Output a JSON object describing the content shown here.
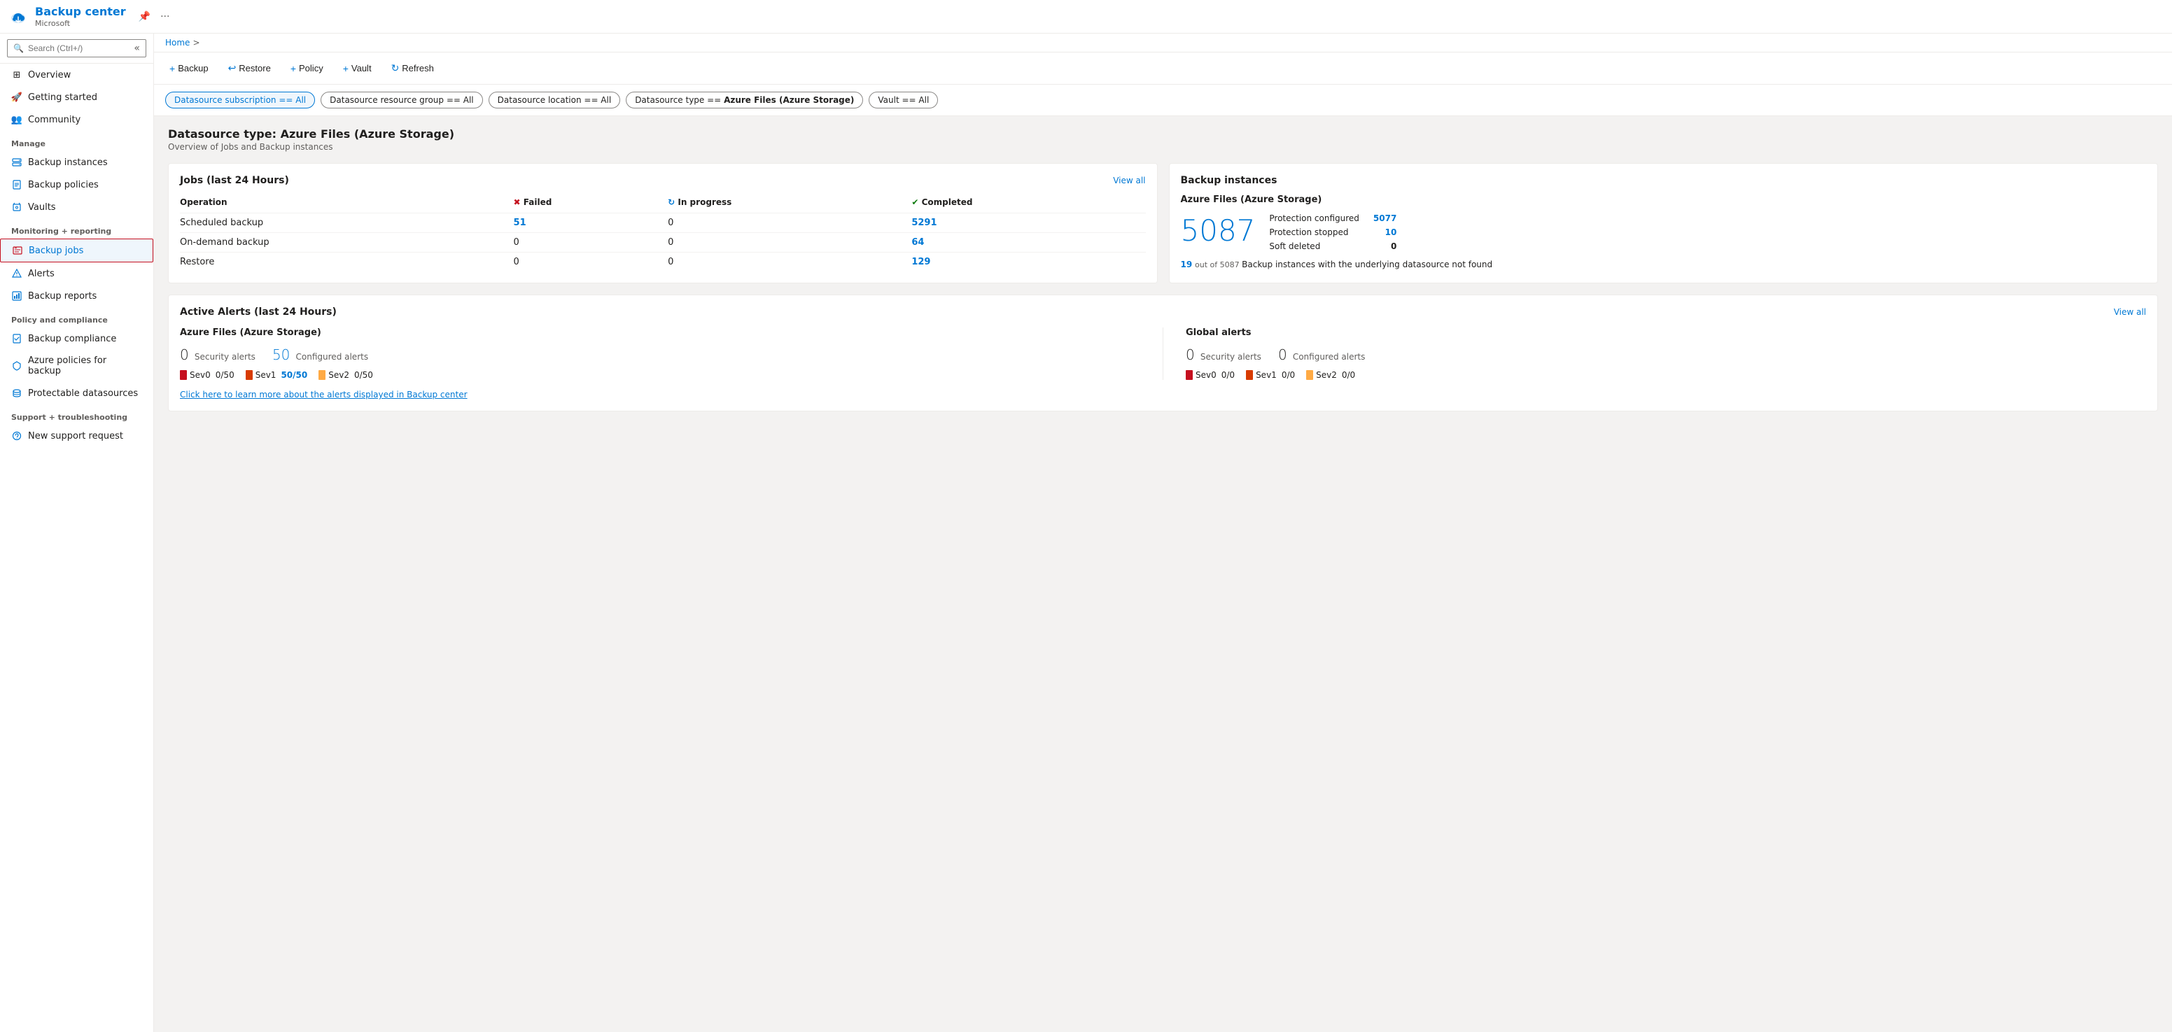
{
  "header": {
    "title": "Backup center",
    "subtitle": "Microsoft",
    "pin_label": "📌",
    "more_label": "..."
  },
  "breadcrumb": {
    "home": "Home",
    "separator": ">"
  },
  "search": {
    "placeholder": "Search (Ctrl+/)"
  },
  "sidebar": {
    "nav_items": [
      {
        "id": "overview",
        "label": "Overview",
        "icon": "grid"
      },
      {
        "id": "getting-started",
        "label": "Getting started",
        "icon": "rocket"
      },
      {
        "id": "community",
        "label": "Community",
        "icon": "people"
      }
    ],
    "sections": [
      {
        "label": "Manage",
        "items": [
          {
            "id": "backup-instances",
            "label": "Backup instances",
            "icon": "server"
          },
          {
            "id": "backup-policies",
            "label": "Backup policies",
            "icon": "policy"
          },
          {
            "id": "vaults",
            "label": "Vaults",
            "icon": "vault"
          }
        ]
      },
      {
        "label": "Monitoring + reporting",
        "items": [
          {
            "id": "backup-jobs",
            "label": "Backup jobs",
            "icon": "jobs",
            "active": true,
            "highlighted": true
          },
          {
            "id": "alerts",
            "label": "Alerts",
            "icon": "alert"
          },
          {
            "id": "backup-reports",
            "label": "Backup reports",
            "icon": "reports"
          }
        ]
      },
      {
        "label": "Policy and compliance",
        "items": [
          {
            "id": "backup-compliance",
            "label": "Backup compliance",
            "icon": "compliance"
          },
          {
            "id": "azure-policies",
            "label": "Azure policies for backup",
            "icon": "azure-policy"
          },
          {
            "id": "protectable-datasources",
            "label": "Protectable datasources",
            "icon": "datasource"
          }
        ]
      },
      {
        "label": "Support + troubleshooting",
        "items": [
          {
            "id": "new-support-request",
            "label": "New support request",
            "icon": "support"
          }
        ]
      }
    ]
  },
  "toolbar": {
    "buttons": [
      {
        "id": "backup",
        "label": "Backup",
        "icon": "+"
      },
      {
        "id": "restore",
        "label": "Restore",
        "icon": "↩"
      },
      {
        "id": "policy",
        "label": "Policy",
        "icon": "+"
      },
      {
        "id": "vault",
        "label": "Vault",
        "icon": "+"
      },
      {
        "id": "refresh",
        "label": "Refresh",
        "icon": "↻"
      }
    ]
  },
  "filters": [
    {
      "id": "datasource-subscription",
      "label": "Datasource subscription == All",
      "active": true
    },
    {
      "id": "datasource-resource-group",
      "label": "Datasource resource group == All",
      "active": false
    },
    {
      "id": "datasource-location",
      "label": "Datasource location == All",
      "active": false
    },
    {
      "id": "datasource-type",
      "label": "Datasource type == Azure Files (Azure Storage)",
      "active": false
    },
    {
      "id": "vault",
      "label": "Vault == All",
      "active": false
    }
  ],
  "page": {
    "heading": "Datasource type: Azure Files (Azure Storage)",
    "subheading": "Overview of Jobs and Backup instances"
  },
  "jobs_card": {
    "title": "Jobs (last 24 Hours)",
    "view_all": "View all",
    "columns": [
      "Operation",
      "Failed",
      "In progress",
      "Completed"
    ],
    "rows": [
      {
        "operation": "Scheduled backup",
        "failed": "51",
        "in_progress": "0",
        "completed": "5291"
      },
      {
        "operation": "On-demand backup",
        "failed": "0",
        "in_progress": "0",
        "completed": "64"
      },
      {
        "operation": "Restore",
        "failed": "0",
        "in_progress": "0",
        "completed": "129"
      }
    ]
  },
  "backup_instances_card": {
    "title": "Backup instances",
    "subtitle": "Azure Files (Azure Storage)",
    "big_number": "5087",
    "stats": [
      {
        "label": "Protection configured",
        "value": "5077",
        "is_link": true
      },
      {
        "label": "Protection stopped",
        "value": "10",
        "is_link": true
      },
      {
        "label": "Soft deleted",
        "value": "0",
        "is_black": true
      }
    ],
    "underlying_count": "19",
    "underlying_sub": "out of 5087",
    "underlying_text": "Backup instances with the underlying datasource not found"
  },
  "alerts_card": {
    "title": "Active Alerts (last 24 Hours)",
    "view_all": "View all",
    "azure_section": {
      "title": "Azure Files (Azure Storage)",
      "security_count": "0",
      "security_label": "Security alerts",
      "configured_count": "50",
      "configured_label": "Configured alerts",
      "configured_is_blue": true,
      "sevs": [
        {
          "label": "Sev0",
          "value": "0/50",
          "color": "red",
          "is_blue": false
        },
        {
          "label": "Sev1",
          "value": "50/50",
          "color": "orange",
          "is_blue": true
        },
        {
          "label": "Sev2",
          "value": "0/50",
          "color": "yellow",
          "is_blue": false
        }
      ]
    },
    "global_section": {
      "title": "Global alerts",
      "security_count": "0",
      "security_label": "Security alerts",
      "configured_count": "0",
      "configured_label": "Configured alerts",
      "configured_is_blue": false,
      "sevs": [
        {
          "label": "Sev0",
          "value": "0/0",
          "color": "red",
          "is_blue": false
        },
        {
          "label": "Sev1",
          "value": "0/0",
          "color": "orange",
          "is_blue": false
        },
        {
          "label": "Sev2",
          "value": "0/0",
          "color": "yellow",
          "is_blue": false
        }
      ]
    },
    "learn_link": "Click here to learn more about the alerts displayed in Backup center"
  }
}
